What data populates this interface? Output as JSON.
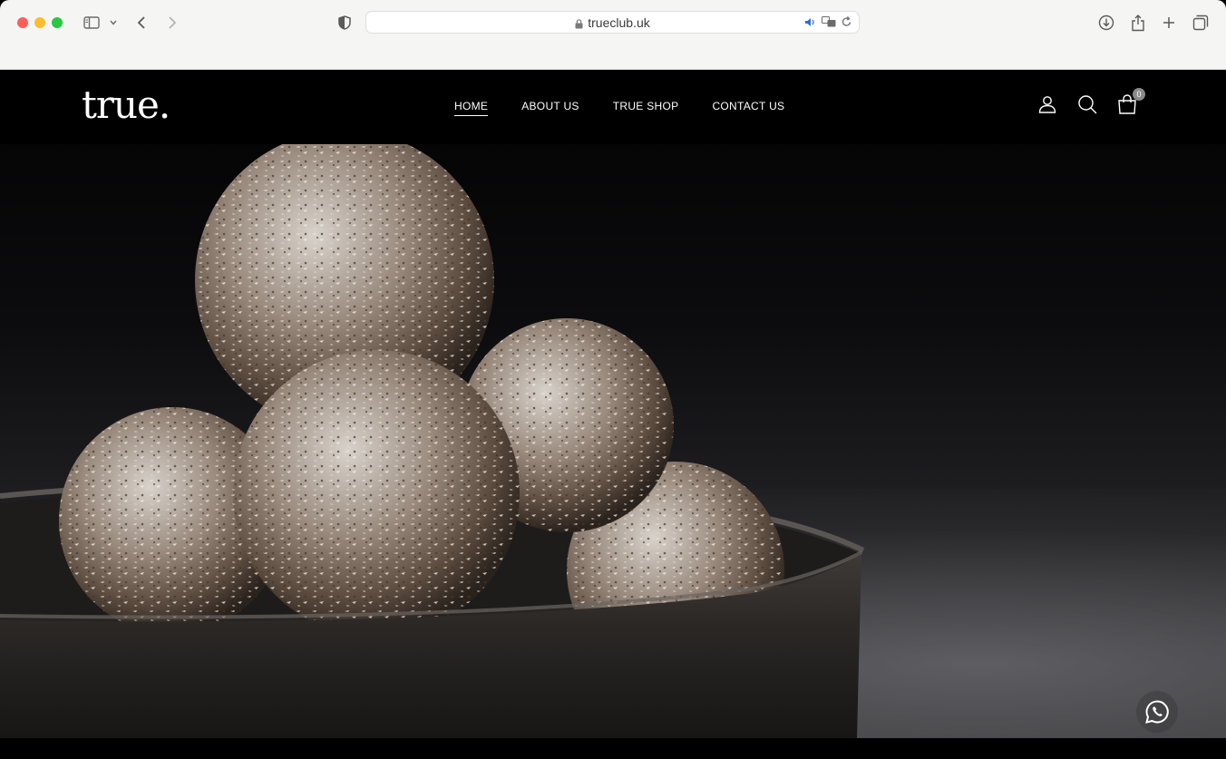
{
  "browser": {
    "url": "trueclub.uk",
    "icons": [
      "sidebar-icon",
      "chevron-down-icon",
      "back-icon",
      "forward-icon",
      "shield-icon",
      "lock-icon",
      "speaker-icon",
      "translate-icon",
      "reload-icon",
      "download-icon",
      "share-icon",
      "plus-icon",
      "tabs-icon"
    ]
  },
  "site": {
    "logo": "true.",
    "nav": [
      {
        "label": "HOME",
        "active": true
      },
      {
        "label": "ABOUT US",
        "active": false
      },
      {
        "label": "TRUE SHOP",
        "active": false
      },
      {
        "label": "CONTACT US",
        "active": false
      }
    ],
    "header_icons": [
      "account-icon",
      "search-icon",
      "cart-icon"
    ],
    "cart_count": "0"
  },
  "hero": {
    "image": "coconut-energy-balls-in-bowl",
    "whatsapp_icon": "whatsapp-icon"
  }
}
